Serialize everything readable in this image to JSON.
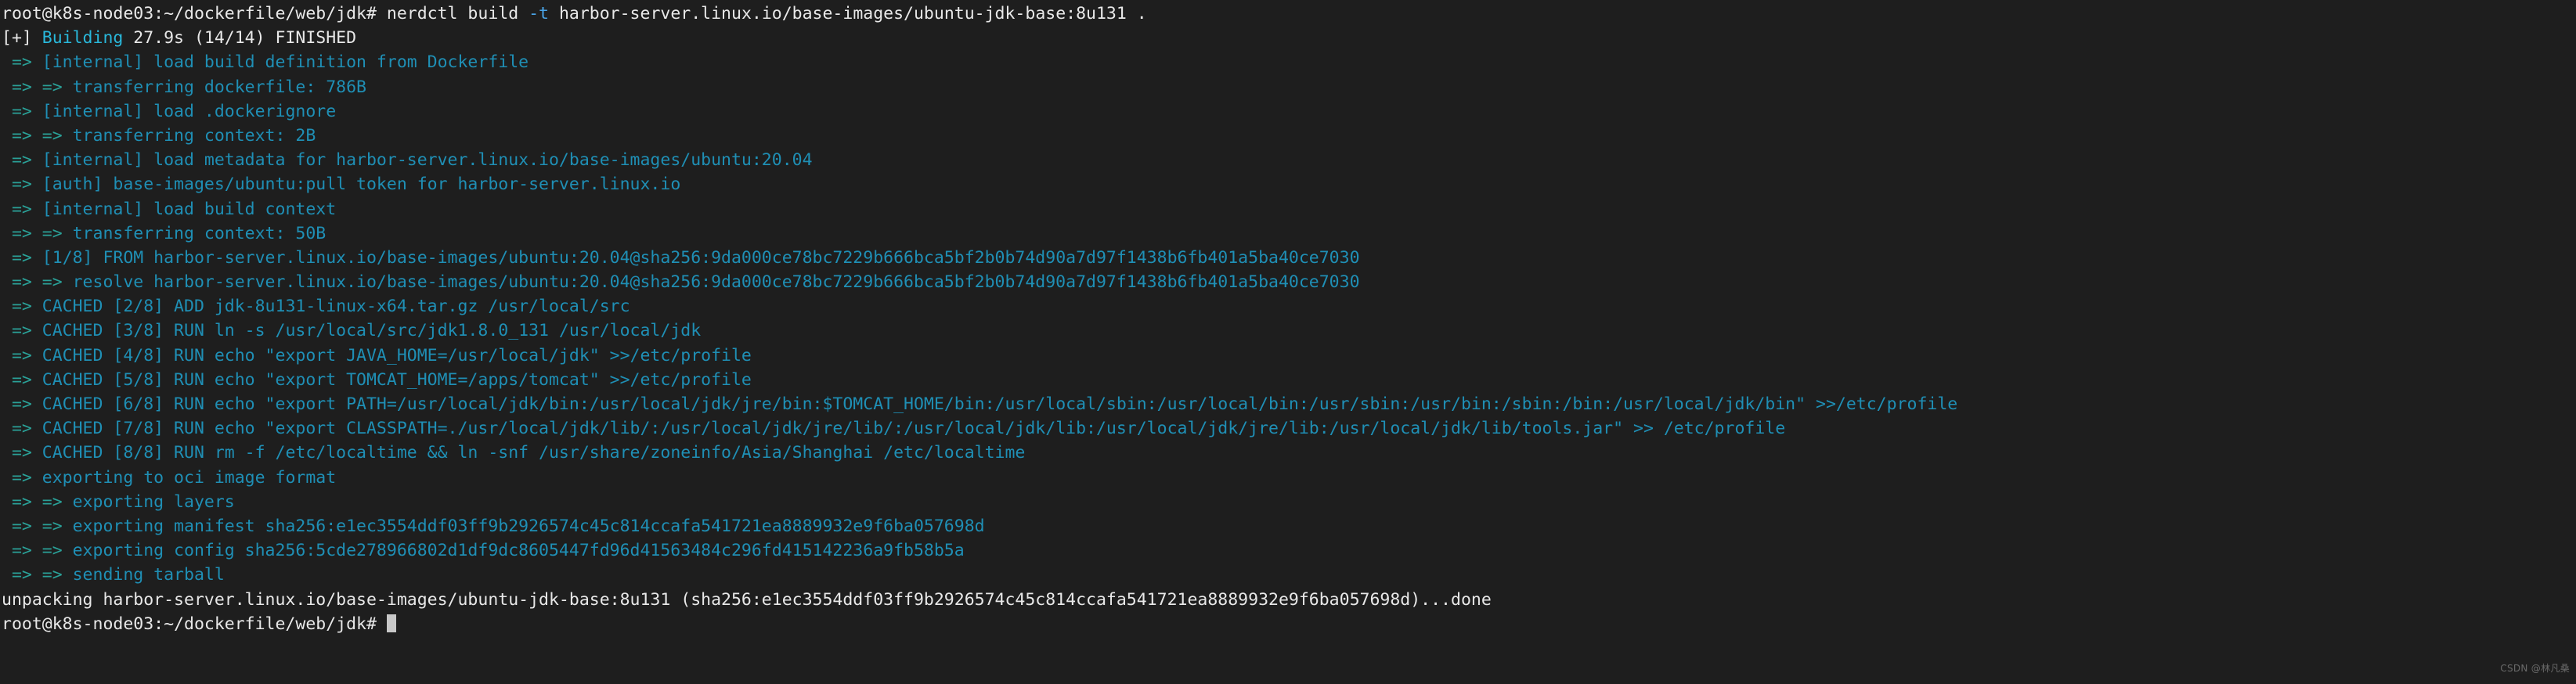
{
  "terminal": {
    "title": "nerdctl build terminal",
    "colors": {
      "background": "#1e1e1e",
      "foreground": "#d8dee9",
      "prompt": "#e8e8e8",
      "cyan": "#1f8fb5",
      "cyan_bright": "#29b8db",
      "flag_blue": "#4aa5e8",
      "cursor": "#c8c8c8"
    },
    "prompt": {
      "user_host_path": "root@k8s-node03:~/dockerfile/web/jdk#"
    },
    "command": {
      "binary": "nerdctl",
      "subcommand": "build",
      "flag": "-t",
      "tag": "harbor-server.linux.io/base-images/ubuntu-jdk-base:8u131",
      "context": "."
    },
    "build_status": {
      "bracket": "[+]",
      "label": "Building",
      "elapsed": "27.9s",
      "steps": "(14/14)",
      "state": "FINISHED"
    },
    "lines": [
      {
        "type": "prompt_command",
        "prompt": "root@k8s-node03:~/dockerfile/web/jdk#",
        "pre": " nerdctl build ",
        "flag": "-t",
        "post": " harbor-server.linux.io/base-images/ubuntu-jdk-base:8u131 ."
      },
      {
        "type": "status",
        "bracket": "[+] ",
        "label": "Building ",
        "rest": "27.9s (14/14) FINISHED"
      },
      {
        "type": "step",
        "arrow": " => ",
        "text": "[internal] load build definition from Dockerfile"
      },
      {
        "type": "step",
        "arrow": " => => ",
        "text": "transferring dockerfile: 786B"
      },
      {
        "type": "step",
        "arrow": " => ",
        "text": "[internal] load .dockerignore"
      },
      {
        "type": "step",
        "arrow": " => => ",
        "text": "transferring context: 2B"
      },
      {
        "type": "step",
        "arrow": " => ",
        "text": "[internal] load metadata for harbor-server.linux.io/base-images/ubuntu:20.04"
      },
      {
        "type": "step",
        "arrow": " => ",
        "text": "[auth] base-images/ubuntu:pull token for harbor-server.linux.io"
      },
      {
        "type": "step",
        "arrow": " => ",
        "text": "[internal] load build context"
      },
      {
        "type": "step",
        "arrow": " => => ",
        "text": "transferring context: 50B"
      },
      {
        "type": "step",
        "arrow": " => ",
        "text": "[1/8] FROM harbor-server.linux.io/base-images/ubuntu:20.04@sha256:9da000ce78bc7229b666bca5bf2b0b74d90a7d97f1438b6fb401a5ba40ce7030"
      },
      {
        "type": "step",
        "arrow": " => => ",
        "text": "resolve harbor-server.linux.io/base-images/ubuntu:20.04@sha256:9da000ce78bc7229b666bca5bf2b0b74d90a7d97f1438b6fb401a5ba40ce7030"
      },
      {
        "type": "step",
        "arrow": " => ",
        "text": "CACHED [2/8] ADD jdk-8u131-linux-x64.tar.gz /usr/local/src"
      },
      {
        "type": "step",
        "arrow": " => ",
        "text": "CACHED [3/8] RUN ln -s /usr/local/src/jdk1.8.0_131 /usr/local/jdk"
      },
      {
        "type": "step",
        "arrow": " => ",
        "text": "CACHED [4/8] RUN echo \"export JAVA_HOME=/usr/local/jdk\" >>/etc/profile"
      },
      {
        "type": "step",
        "arrow": " => ",
        "text": "CACHED [5/8] RUN echo \"export TOMCAT_HOME=/apps/tomcat\" >>/etc/profile"
      },
      {
        "type": "step",
        "arrow": " => ",
        "text": "CACHED [6/8] RUN echo \"export PATH=/usr/local/jdk/bin:/usr/local/jdk/jre/bin:$TOMCAT_HOME/bin:/usr/local/sbin:/usr/local/bin:/usr/sbin:/usr/bin:/sbin:/bin:/usr/local/jdk/bin\" >>/etc/profile"
      },
      {
        "type": "step",
        "arrow": " => ",
        "text": "CACHED [7/8] RUN echo \"export CLASSPATH=./usr/local/jdk/lib/:/usr/local/jdk/jre/lib/:/usr/local/jdk/lib:/usr/local/jdk/jre/lib:/usr/local/jdk/lib/tools.jar\" >> /etc/profile"
      },
      {
        "type": "step",
        "arrow": " => ",
        "text": "CACHED [8/8] RUN rm -f /etc/localtime && ln -snf /usr/share/zoneinfo/Asia/Shanghai /etc/localtime"
      },
      {
        "type": "step",
        "arrow": " => ",
        "text": "exporting to oci image format"
      },
      {
        "type": "step",
        "arrow": " => => ",
        "text": "exporting layers"
      },
      {
        "type": "step",
        "arrow": " => => ",
        "text": "exporting manifest sha256:e1ec3554ddf03ff9b2926574c45c814ccafa541721ea8889932e9f6ba057698d"
      },
      {
        "type": "step",
        "arrow": " => => ",
        "text": "exporting config sha256:5cde278966802d1df9dc8605447fd96d41563484c296fd415142236a9fb58b5a"
      },
      {
        "type": "step",
        "arrow": " => => ",
        "text": "sending tarball"
      },
      {
        "type": "plain",
        "text": "unpacking harbor-server.linux.io/base-images/ubuntu-jdk-base:8u131 (sha256:e1ec3554ddf03ff9b2926574c45c814ccafa541721ea8889932e9f6ba057698d)...done"
      },
      {
        "type": "prompt_cursor",
        "prompt": "root@k8s-node03:~/dockerfile/web/jdk#"
      }
    ]
  },
  "watermark": {
    "text": "CSDN @林凡桑"
  }
}
